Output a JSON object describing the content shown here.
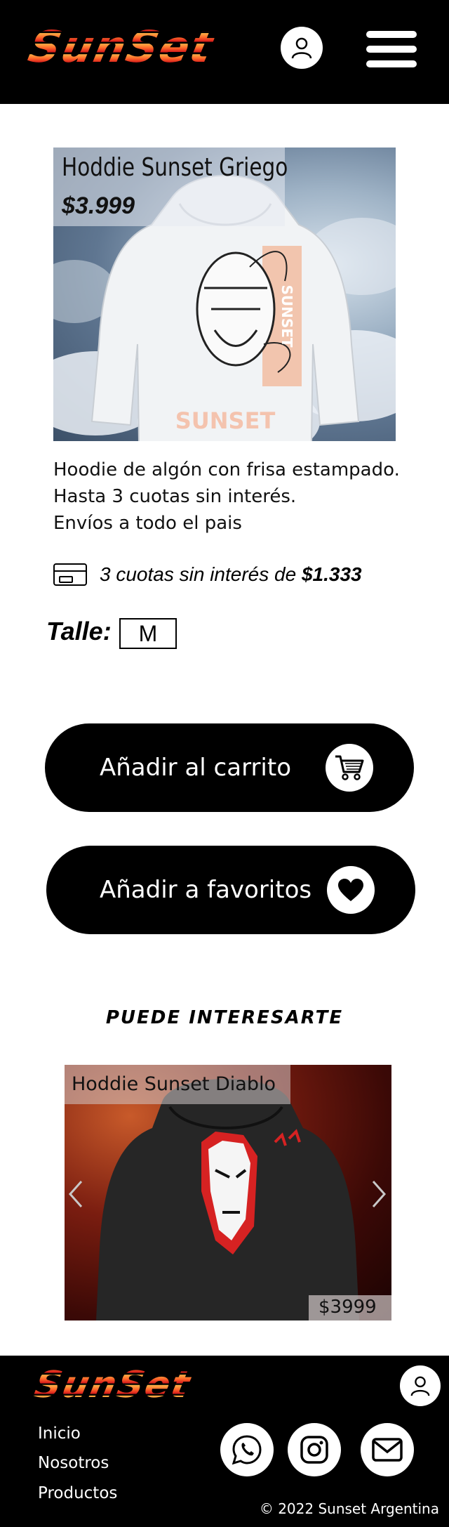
{
  "brand": {
    "logo_text": "SunSet"
  },
  "product": {
    "title": "Hoddie Sunset Griego",
    "price": "$3.999",
    "description": [
      "Hoodie de algón con frisa estampado.",
      "Hasta 3 cuotas sin interés.",
      "Envíos a todo el pais"
    ],
    "installments_text": "3 cuotas sin interés de",
    "installments_amount": "$1.333",
    "print_text": "SUNSET",
    "size_label": "Talle:",
    "size_value": "M"
  },
  "actions": {
    "add_to_cart": "Añadir al carrito",
    "add_to_favorites": "Añadir a favoritos"
  },
  "recommendations": {
    "section_title": "PUEDE INTERESARTE",
    "items": [
      {
        "title": "Hoddie Sunset Diablo",
        "price": "$3999"
      }
    ]
  },
  "footer": {
    "links": [
      "Inicio",
      "Nosotros",
      "Productos"
    ],
    "copyright": "© 2022 Sunset Argentina",
    "social_icons": [
      "whatsapp-icon",
      "instagram-icon",
      "mail-icon"
    ]
  },
  "colors": {
    "logo_gradient": [
      "#ffb347",
      "#ff6a2a",
      "#d71b1b"
    ],
    "header_bg": "#000000",
    "button_bg": "#000000"
  }
}
